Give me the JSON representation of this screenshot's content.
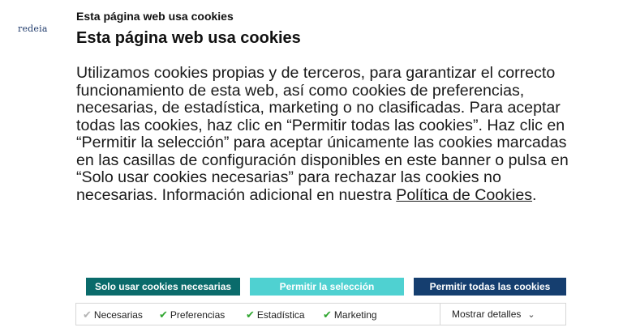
{
  "brand": {
    "logo_text": "redeia"
  },
  "dialog": {
    "label": "Esta página web usa cookies",
    "title": "Esta página web usa cookies",
    "body": "Utilizamos cookies propias y de terceros, para garantizar el correcto funcionamiento de esta web, así como cookies de preferencias, necesarias, de estadística, marketing o no clasificadas. Para aceptar todas las cookies, haz clic en “Permitir todas las cookies”. Haz clic en “Permitir la selección” para aceptar únicamente las cookies marcadas en las casillas de configuración disponibles en este banner o pulsa en “Solo usar cookies necesarias” para rechazar las cookies no necesarias. Información adicional en nuestra",
    "policy_link": "Política de Cookies",
    "period": "."
  },
  "buttons": {
    "necessary": "Solo usar cookies necesarias",
    "selection": "Permitir la selección",
    "all": "Permitir todas las cookies"
  },
  "categories": [
    {
      "label": "Necesarias",
      "checked": true,
      "disabled": true
    },
    {
      "label": "Preferencias",
      "checked": true,
      "disabled": false
    },
    {
      "label": "Estadística",
      "checked": true,
      "disabled": false
    },
    {
      "label": "Marketing",
      "checked": true,
      "disabled": false
    }
  ],
  "details": {
    "label": "Mostrar detalles"
  },
  "colors": {
    "necessary_button": "#0a6b6b",
    "selection_button": "#4fd1d1",
    "all_button": "#153e6f",
    "check_green": "#2fa62f"
  }
}
